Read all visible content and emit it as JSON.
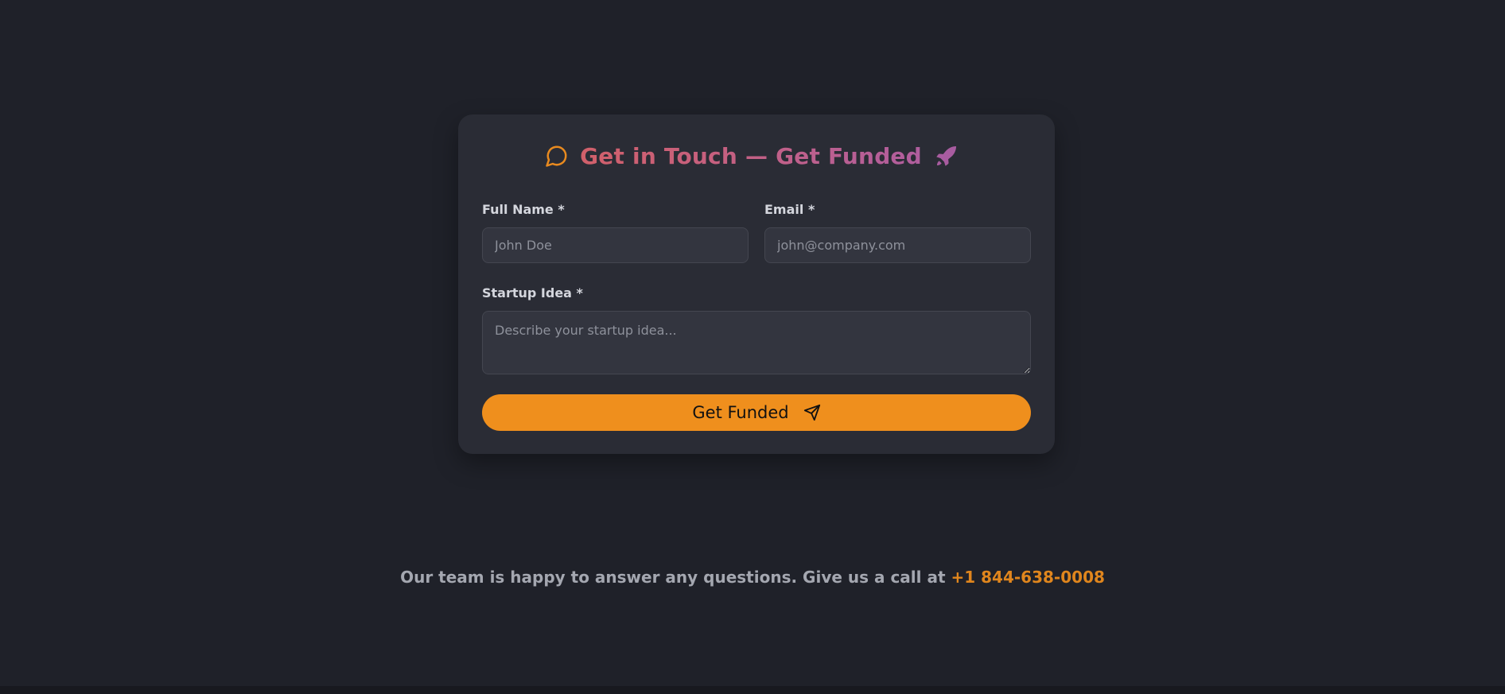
{
  "form": {
    "title": "Get in Touch — Get Funded",
    "title_icon_left": "chat-bubble-icon",
    "title_icon_right": "rocket-icon",
    "full_name": {
      "label": "Full Name *",
      "placeholder": "John Doe",
      "value": ""
    },
    "email": {
      "label": "Email *",
      "placeholder": "john@company.com",
      "value": ""
    },
    "startup_idea": {
      "label": "Startup Idea *",
      "placeholder": "Describe your startup idea...",
      "value": ""
    },
    "submit": {
      "label": "Get Funded",
      "icon": "send-icon"
    }
  },
  "footer": {
    "text": "Our team is happy to answer any questions. Give us a call at",
    "phone": "+1 844-638-0008"
  },
  "colors": {
    "background": "#1f2129",
    "card": "#2a2c35",
    "accent": "#ef8f1d",
    "title_gradient_start": "#d1606a",
    "title_gradient_end": "#b05e9e"
  }
}
